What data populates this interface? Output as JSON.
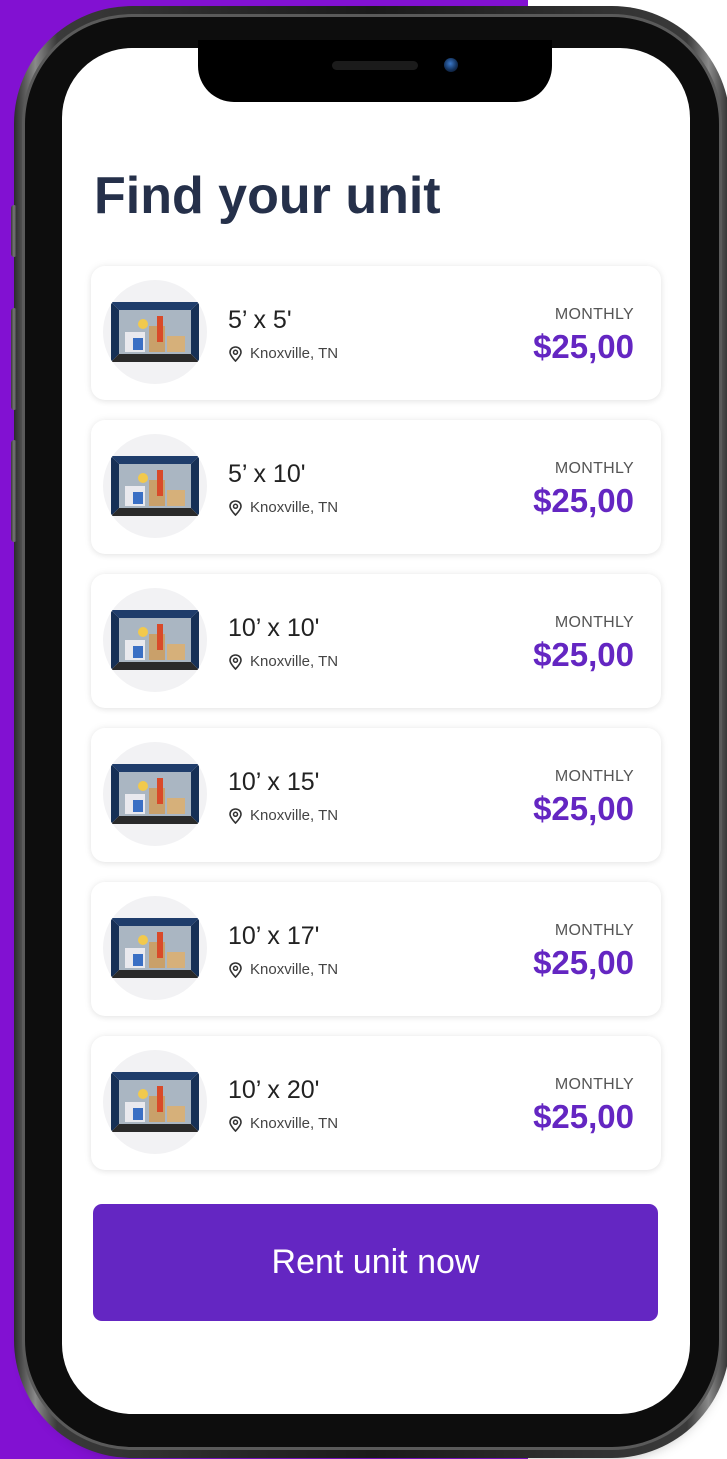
{
  "page": {
    "title": "Find your unit"
  },
  "colors": {
    "background_left": "#8211d2",
    "accent": "#6426c2",
    "title": "#25304a"
  },
  "units": [
    {
      "size": "5’ x 5'",
      "location": "Knoxville, TN",
      "price_label": "MONTHLY",
      "price": "$25,00",
      "icon": "location-pin-icon"
    },
    {
      "size": "5’ x 10'",
      "location": "Knoxville, TN",
      "price_label": "MONTHLY",
      "price": "$25,00",
      "icon": "location-pin-icon"
    },
    {
      "size": "10’ x 10'",
      "location": "Knoxville, TN",
      "price_label": "MONTHLY",
      "price": "$25,00",
      "icon": "location-pin-icon"
    },
    {
      "size": "10’ x 15'",
      "location": "Knoxville, TN",
      "price_label": "MONTHLY",
      "price": "$25,00",
      "icon": "location-pin-icon"
    },
    {
      "size": "10’ x 17'",
      "location": "Knoxville, TN",
      "price_label": "MONTHLY",
      "price": "$25,00",
      "icon": "location-pin-icon"
    },
    {
      "size": "10’ x 20'",
      "location": "Knoxville, TN",
      "price_label": "MONTHLY",
      "price": "$25,00",
      "icon": "location-pin-icon"
    }
  ],
  "cta": {
    "label": "Rent unit now"
  }
}
